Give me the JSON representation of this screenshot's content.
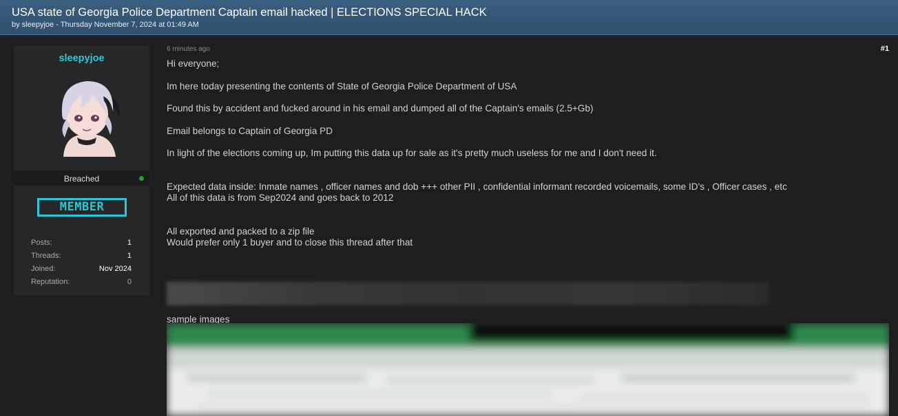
{
  "thread": {
    "title": "USA state of Georgia Police Department Captain email hacked | ELECTIONS SPECIAL HACK",
    "meta": "by sleepyjoe - Thursday November 7, 2024 at 01:49 AM"
  },
  "author": {
    "name": "sleepyjoe",
    "status": "Breached",
    "online": true,
    "rank": "MEMBER",
    "stats": [
      {
        "label": "Posts:",
        "value": "1"
      },
      {
        "label": "Threads:",
        "value": "1"
      },
      {
        "label": "Joined:",
        "value": "Nov 2024"
      },
      {
        "label": "Reputation:",
        "value": "0"
      }
    ]
  },
  "post": {
    "time": "6 minutes ago",
    "number": "#1",
    "lines": [
      "Hi everyone;",
      "Im here today presenting the contents of State of Georgia Police Department of USA",
      "Found this by accident and fucked around in his email and dumped all of the Captain's emails (2.5+Gb)",
      "Email belongs to Captain of Georgia PD",
      "In light of the elections coming up, Im putting this data up for sale as it's pretty much useless for me and I don't need it.",
      "Expected data inside: Inmate names , officer names and dob +++ other PII , confidential informant recorded voicemails, some ID's , Officer cases , etc",
      "All of this data is from Sep2024 and goes back to 2012",
      "All exported and packed to a zip file",
      "Would prefer only 1 buyer and to close this thread after that"
    ],
    "sample_label": "sample images"
  },
  "colors": {
    "accent": "#2ec6d6",
    "header_bg": "#34587a",
    "page_bg": "#1e1e1e",
    "panel_bg": "#252728",
    "online": "#2e9b3c"
  }
}
